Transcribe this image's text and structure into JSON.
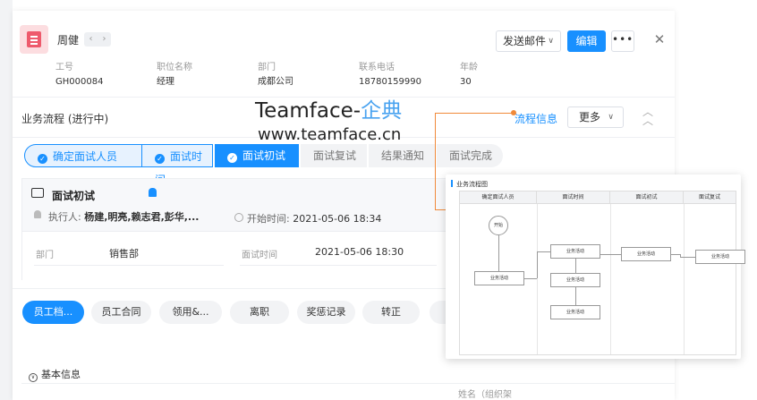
{
  "header": {
    "name": "周健",
    "send_mail": "发送邮件",
    "edit": "编辑",
    "more_dots": "•••",
    "close": "✕"
  },
  "fields": [
    {
      "label": "工号",
      "value": "GH000084"
    },
    {
      "label": "职位名称",
      "value": "经理"
    },
    {
      "label": "部门",
      "value": "成都公司"
    },
    {
      "label": "联系电话",
      "value": "18780159990"
    },
    {
      "label": "年龄",
      "value": "30"
    }
  ],
  "process": {
    "title": "业务流程 (进行中)",
    "flow_info_link": "流程信息",
    "more": "更多"
  },
  "steps": [
    {
      "label": "确定面试人员",
      "state": "done"
    },
    {
      "label": "面试时间",
      "state": "done"
    },
    {
      "label": "面试初试",
      "state": "active"
    },
    {
      "label": "面试复试",
      "state": "todo"
    },
    {
      "label": "结果通知",
      "state": "todo"
    },
    {
      "label": "面试完成",
      "state": "todo"
    }
  ],
  "node_card": {
    "title": "面试初试",
    "executor_label": "执行人:",
    "executors": "杨建,明亮,赖志君,彭华,...",
    "start_label": "开始时间:",
    "start_time": "2021-05-06 18:34",
    "dept_label": "部门",
    "dept_value": "销售部",
    "interview_time_label": "面试时间",
    "interview_time_value": "2021-05-06 18:30"
  },
  "tabs": [
    "员工档...",
    "员工合同",
    "领用&...",
    "离职",
    "奖惩记录",
    "转正"
  ],
  "basic_info": "基本信息",
  "name_org": "姓名（组织架",
  "watermark": {
    "brand_en": "Teamface-",
    "brand_cn": "企典",
    "url": "www.teamface.cn"
  },
  "flowchart": {
    "title": "业务流程图",
    "lanes": [
      "确定面试人员",
      "面试时间",
      "面试初试",
      "面试复试"
    ],
    "start": "开始",
    "node_label": "业务活动"
  },
  "colors": {
    "primary": "#1890ff",
    "connector": "#f08a3a"
  }
}
